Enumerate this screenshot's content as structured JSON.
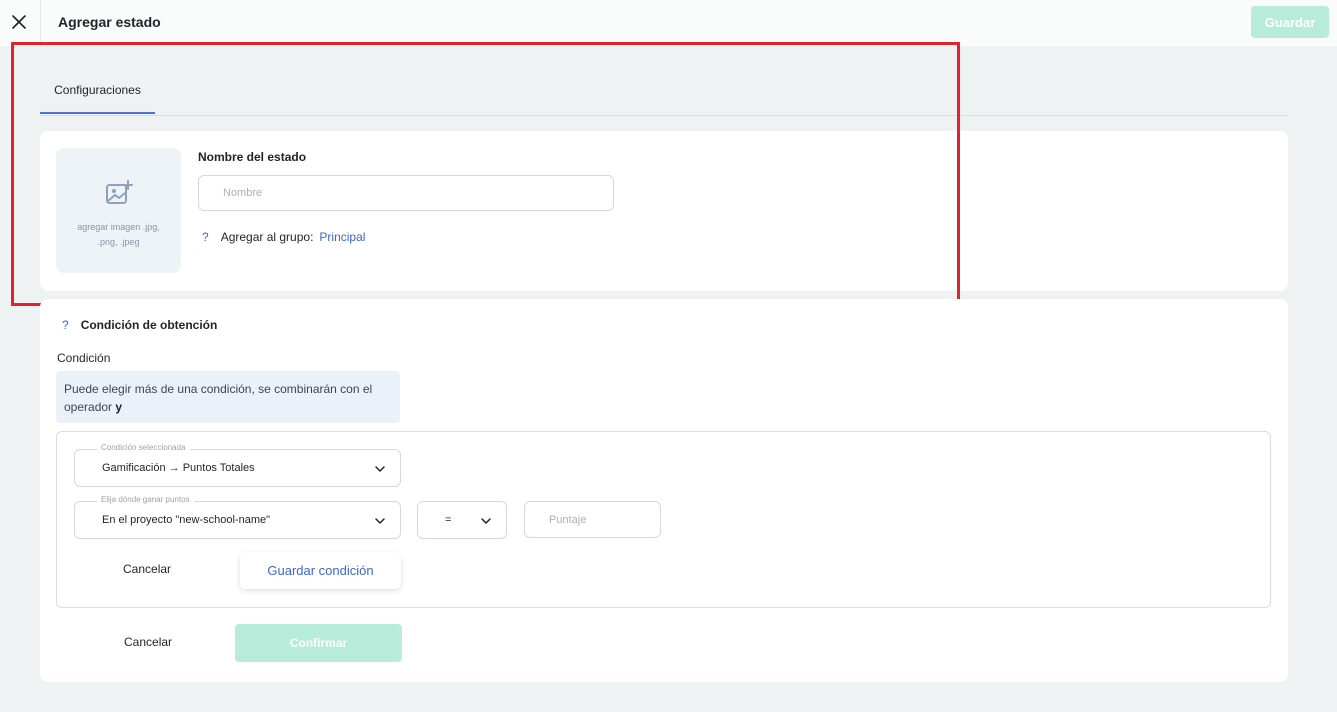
{
  "header": {
    "title": "Agregar estado",
    "save_label": "Guardar"
  },
  "tabs": [
    {
      "label": "Configuraciones",
      "active": true
    }
  ],
  "state_form": {
    "image_upload_text": "agregar imagen .jpg, .png, .jpeg",
    "name_label": "Nombre del estado",
    "name_placeholder": "Nombre",
    "name_value": "",
    "help_icon": "?",
    "group_label": "Agregar al grupo:",
    "group_value": "Principal"
  },
  "condition_section": {
    "help_icon": "?",
    "title": "Condición de obtención",
    "condition_label": "Condición",
    "info_text": "Puede elegir más de una condición, se combinarán con el operador",
    "info_bold": "y",
    "selected_condition": {
      "label": "Condición seleccionada",
      "value": "Gamificación → Puntos Totales"
    },
    "points_location": {
      "label": "Elija dónde ganar puntos",
      "value": "En el proyecto \"new-school-name\""
    },
    "operator": {
      "value": "="
    },
    "score": {
      "placeholder": "Puntaje",
      "value": ""
    },
    "cancel_label": "Cancelar",
    "save_condition_label": "Guardar condición"
  },
  "footer": {
    "cancel_label": "Cancelar",
    "confirm_label": "Confirmar"
  },
  "colors": {
    "accent": "#3d63dd",
    "primary_disabled": "#b7ecdb",
    "highlight": "#e3232c",
    "background": "#eff2f3"
  },
  "icons": {
    "close": "close-icon",
    "image_add": "image-add-icon",
    "chevron": "chevron-down-icon"
  }
}
